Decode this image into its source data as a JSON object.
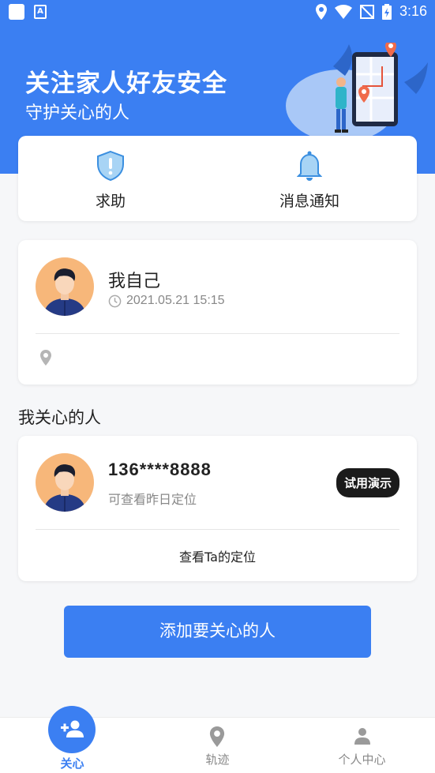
{
  "status_bar": {
    "time": "3:16"
  },
  "hero": {
    "title": "关注家人好友安全",
    "subtitle": "守护关心的人"
  },
  "quick_actions": [
    {
      "label": "求助",
      "icon": "shield-alert-icon"
    },
    {
      "label": "消息通知",
      "icon": "bell-icon"
    }
  ],
  "self_card": {
    "name": "我自己",
    "timestamp": "2021.05.21 15:15",
    "location": ""
  },
  "section_title": "我关心的人",
  "care_card": {
    "phone": "136****8888",
    "description": "可查看昨日定位",
    "badge": "试用演示",
    "view_link": "查看Ta的定位"
  },
  "add_button": "添加要关心的人",
  "tabs": [
    {
      "label": "关心",
      "icon": "add-person-icon",
      "active": true
    },
    {
      "label": "轨迹",
      "icon": "location-pin-icon",
      "active": false
    },
    {
      "label": "个人中心",
      "icon": "person-icon",
      "active": false
    }
  ],
  "colors": {
    "primary": "#3b7ff2",
    "badge_bg": "#1b1b1b",
    "avatar_bg": "#f7b77a"
  }
}
